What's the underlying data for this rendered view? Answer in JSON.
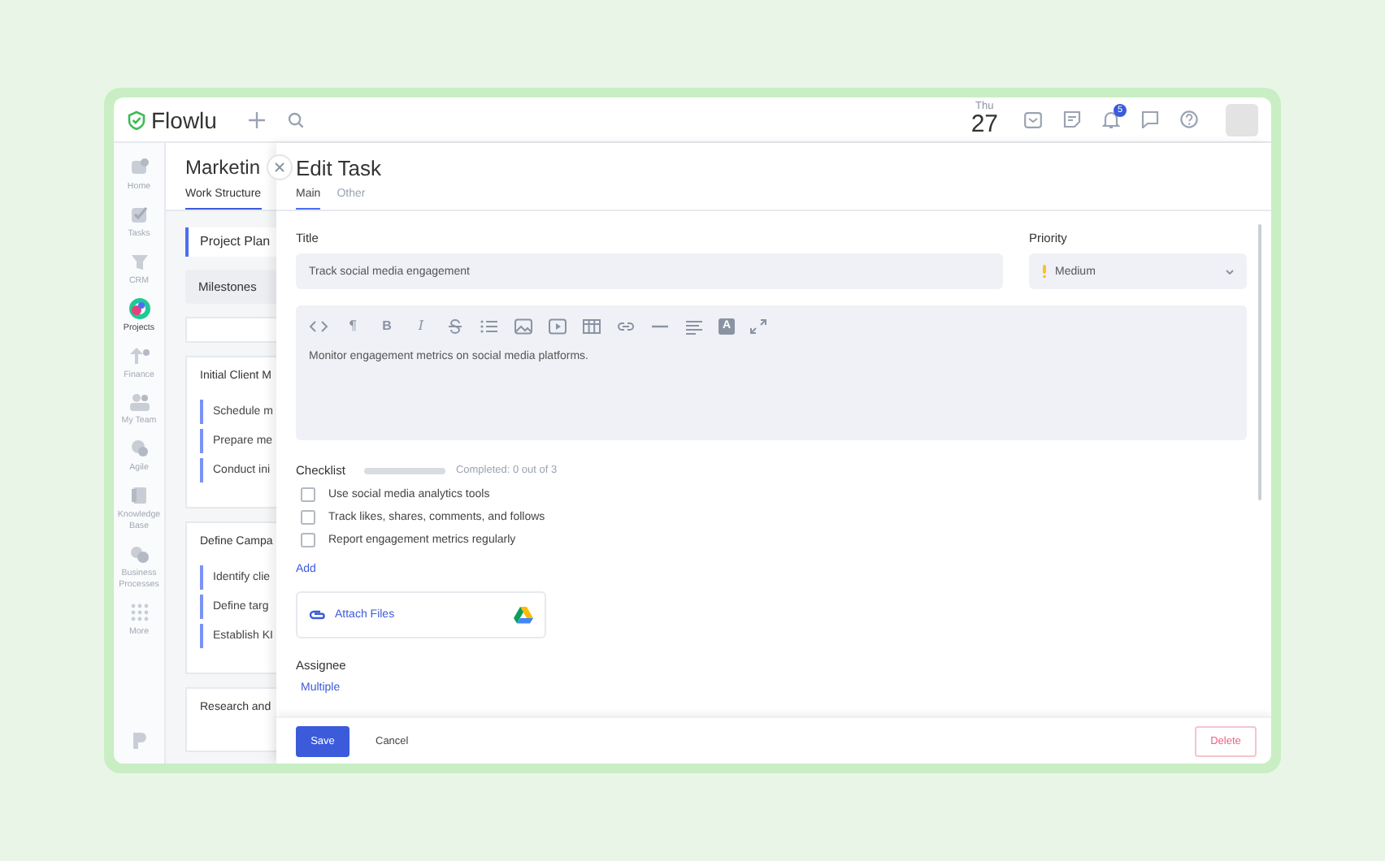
{
  "app": {
    "logo": "Flowlu"
  },
  "topbar": {
    "day": "Thu",
    "date": "27",
    "notification_count": "5"
  },
  "sidebar": {
    "items": [
      {
        "label": "Home",
        "selected": false
      },
      {
        "label": "Tasks",
        "selected": false
      },
      {
        "label": "CRM",
        "selected": false
      },
      {
        "label": "Projects",
        "selected": true
      },
      {
        "label": "Finance",
        "selected": false
      },
      {
        "label": "My Team",
        "selected": false
      },
      {
        "label": "Agile",
        "selected": false
      },
      {
        "label": "Knowledge Base",
        "selected": false
      },
      {
        "label": "Business Processes",
        "selected": false
      },
      {
        "label": "More",
        "selected": false
      }
    ]
  },
  "project": {
    "title": "Marketin",
    "tabs": [
      {
        "label": "Work Structure",
        "selected": true
      }
    ],
    "plan": "Project Plan",
    "milestones": "Milestones",
    "groups": [
      {
        "title": "Initial Client M",
        "tasks": [
          "Schedule m",
          "Prepare me",
          "Conduct ini"
        ]
      },
      {
        "title": "Define Campa",
        "tasks": [
          "Identify clie",
          "Define targ",
          "Establish KI"
        ]
      },
      {
        "title": "Research and"
      }
    ]
  },
  "edit_task": {
    "title": "Edit Task",
    "tabs": [
      {
        "label": "Main",
        "selected": true
      },
      {
        "label": "Other",
        "selected": false
      }
    ],
    "title_field": {
      "label": "Title",
      "value": "Track social media engagement"
    },
    "priority": {
      "label": "Priority",
      "value": "Medium"
    },
    "toolbar": [
      {
        "kind": "code"
      },
      {
        "kind": "glyph",
        "label": "¶"
      },
      {
        "kind": "glyph",
        "label": "B"
      },
      {
        "kind": "glyph",
        "label": "I"
      },
      {
        "kind": "strike"
      },
      {
        "kind": "list"
      },
      {
        "kind": "image"
      },
      {
        "kind": "video"
      },
      {
        "kind": "table"
      },
      {
        "kind": "link"
      },
      {
        "kind": "rule"
      },
      {
        "kind": "align"
      },
      {
        "kind": "boxglyph",
        "label": "A"
      },
      {
        "kind": "expand"
      }
    ],
    "description": "Monitor engagement metrics on social media platforms.",
    "checklist": {
      "label": "Checklist",
      "level": 0,
      "progress_text": "Completed: 0 out of 3",
      "items": [
        {
          "text": "Use social media analytics tools",
          "checked": false
        },
        {
          "text": "Track likes, shares, comments, and follows",
          "checked": false
        },
        {
          "text": "Report engagement metrics regularly",
          "checked": false
        }
      ],
      "add": "Add"
    },
    "attach": "Attach Files",
    "assignee": {
      "label": "Assignee",
      "value": "Multiple"
    },
    "buttons": {
      "save": "Save",
      "cancel": "Cancel",
      "delete": "Delete"
    }
  }
}
